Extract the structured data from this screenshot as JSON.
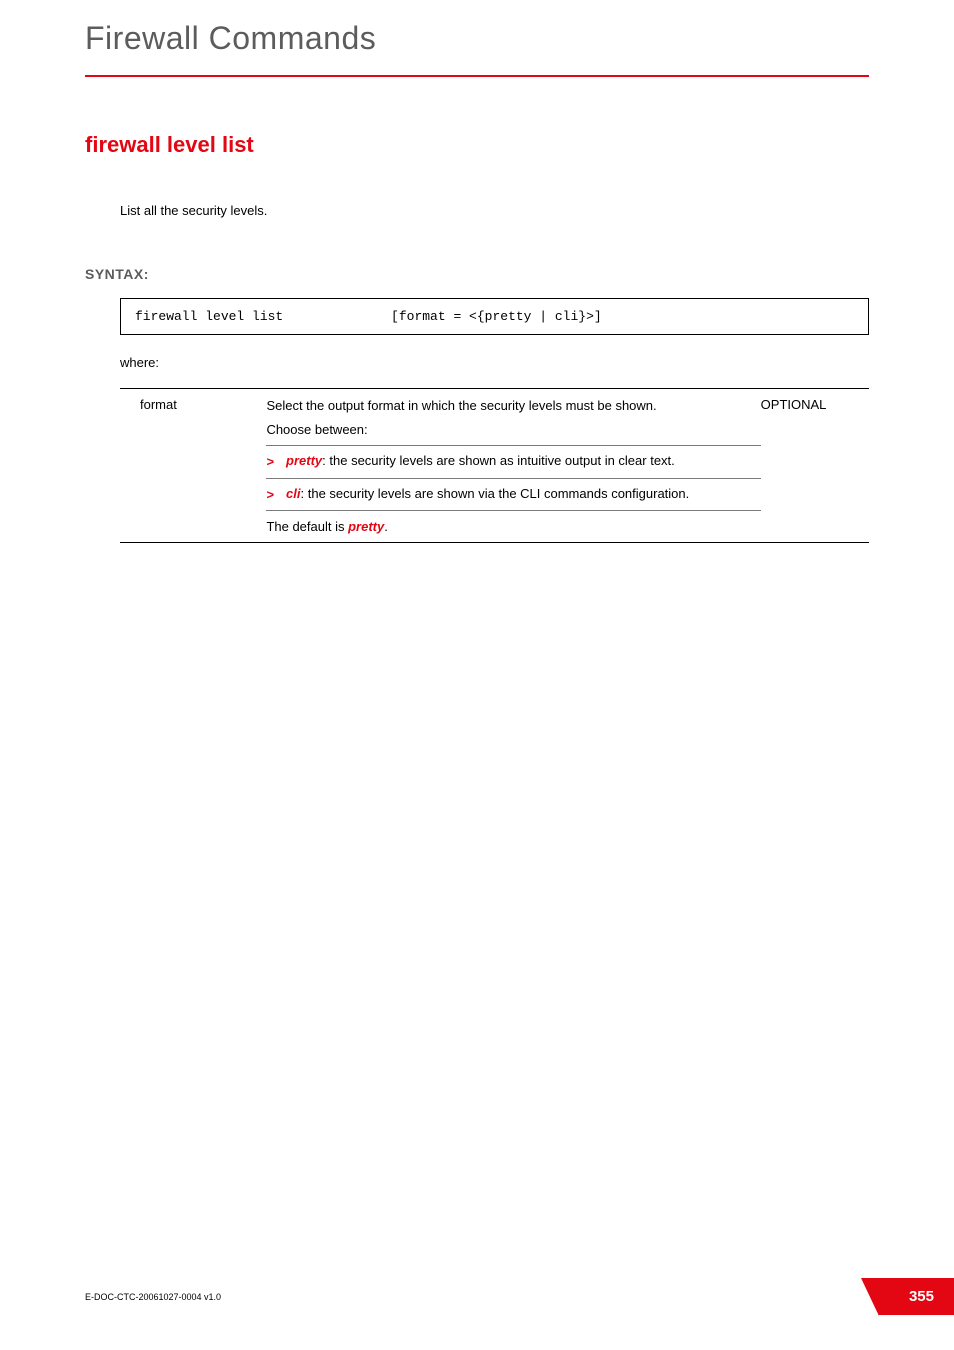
{
  "header": {
    "chapter_title": "Firewall Commands"
  },
  "section": {
    "title": "firewall level list",
    "description": "List all the security levels."
  },
  "syntax": {
    "label": "SYNTAX:",
    "code_cmd": "firewall level list",
    "code_args": "[format = <{pretty | cli}>]",
    "where_label": "where:"
  },
  "param": {
    "name": "format",
    "optional": "OPTIONAL",
    "desc_intro_line1": "Select the output format in which the security levels must be shown.",
    "desc_intro_line2": "Choose between:",
    "bullets": [
      {
        "term": "pretty",
        "text": ": the security levels are shown as intuitive output in clear text."
      },
      {
        "term": "cli",
        "text": ": the security levels are shown via the CLI commands configuration."
      }
    ],
    "default_prefix": "The default is ",
    "default_value": "pretty",
    "default_suffix": "."
  },
  "footer": {
    "doc_id": "E-DOC-CTC-20061027-0004 v1.0",
    "page_number": "355"
  },
  "icons": {
    "bullet": ">"
  }
}
